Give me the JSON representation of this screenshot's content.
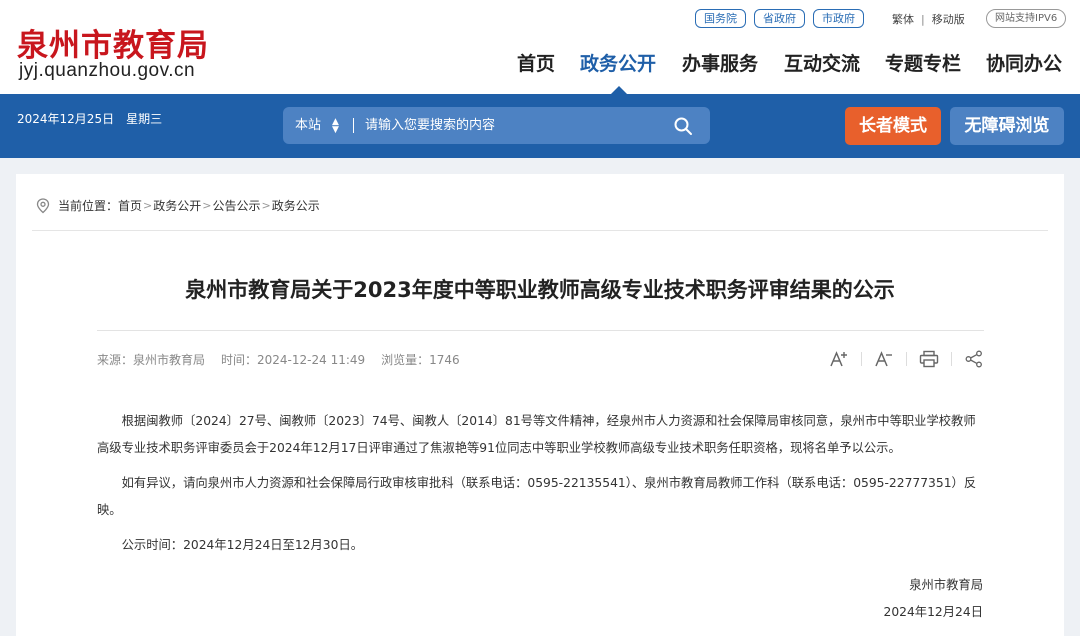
{
  "header": {
    "logo_cn": "泉州市教育局",
    "logo_url": "jyj.quanzhou.gov.cn",
    "top_links": [
      "国务院",
      "省政府",
      "市政府"
    ],
    "lang_traditional": "繁体",
    "mobile_version": "移动版",
    "ipv6": "网站支持IPV6",
    "nav": [
      "首页",
      "政务公开",
      "办事服务",
      "互动交流",
      "专题专栏",
      "协同办公"
    ],
    "active_nav": "政务公开"
  },
  "bar": {
    "date": "2024年12月25日",
    "weekday": "星期三",
    "search_scope": "本站",
    "search_placeholder": "请输入您要搜索的内容",
    "elder_mode": "长者模式",
    "accessible": "无障碍浏览"
  },
  "breadcrumb": {
    "prefix": "当前位置：",
    "items": [
      "首页",
      "政务公开",
      "公告公示",
      "政务公示"
    ],
    "separator": ">"
  },
  "article": {
    "title": "泉州市教育局关于2023年度中等职业教师高级专业技术职务评审结果的公示",
    "source": "来源：泉州市教育局",
    "time": "时间：2024-12-24 11:49",
    "views": "浏览量：1746",
    "paragraphs": [
      "根据闽教师〔2024〕27号、闽教师〔2023〕74号、闽教人〔2014〕81号等文件精神，经泉州市人力资源和社会保障局审核同意，泉州市中等职业学校教师高级专业技术职务评审委员会于2024年12月17日评审通过了焦淑艳等91位同志中等职业学校教师高级专业技术职务任职资格，现将名单予以公示。",
      "如有异议，请向泉州市人力资源和社会保障局行政审核审批科（联系电话：0595-22135541）、泉州市教育局教师工作科（联系电话：0595-22777351）反映。",
      "公示时间：2024年12月24日至12月30日。"
    ],
    "signature": "泉州市教育局",
    "sign_date": "2024年12月24日"
  },
  "colors": {
    "brand_red": "#c8161d",
    "primary_blue": "#1f5fa8",
    "search_blue": "#4d82c3",
    "elder_orange": "#e8602c"
  }
}
